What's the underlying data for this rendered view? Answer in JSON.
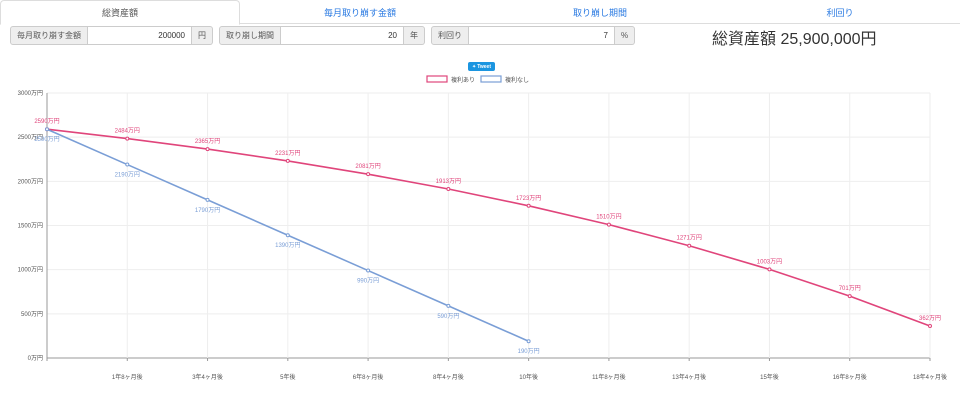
{
  "tabs": [
    {
      "label": "総資産額",
      "active": true
    },
    {
      "label": "毎月取り崩す金額",
      "active": false
    },
    {
      "label": "取り崩し期間",
      "active": false
    },
    {
      "label": "利回り",
      "active": false
    }
  ],
  "controls": {
    "monthly": {
      "label": "毎月取り崩す金額",
      "value": "200000",
      "unit": "円"
    },
    "period": {
      "label": "取り崩し期間",
      "value": "20",
      "unit": "年"
    },
    "rate": {
      "label": "利回り",
      "value": "7",
      "unit": "%"
    }
  },
  "total_text": "総資産額 25,900,000円",
  "tweet_label": "Tweet",
  "colors": {
    "compound": "#e0457b",
    "simple": "#7a9ed6",
    "link": "#2a7ae2"
  },
  "chart_data": {
    "type": "line",
    "categories": [
      "",
      "1年8ヶ月後",
      "3年4ヶ月後",
      "5年後",
      "6年8ヶ月後",
      "8年4ヶ月後",
      "10年後",
      "11年8ヶ月後",
      "13年4ヶ月後",
      "15年後",
      "16年8ヶ月後",
      "18年4ヶ月後"
    ],
    "yticks": [
      "0万円",
      "500万円",
      "1000万円",
      "1500万円",
      "2000万円",
      "2500万円",
      "3000万円"
    ],
    "ylim": [
      0,
      3000
    ],
    "grid": true,
    "legend_position": "top-center",
    "series": [
      {
        "name": "複利あり",
        "color": "#e0457b",
        "values": [
          2590,
          2484,
          2365,
          2231,
          2081,
          1913,
          1723,
          1510,
          1271,
          1003,
          701,
          362
        ],
        "labels": [
          "2590万円",
          "2484万円",
          "2365万円",
          "2231万円",
          "2081万円",
          "1913万円",
          "1723万円",
          "1510万円",
          "1271万円",
          "1003万円",
          "701万円",
          "362万円"
        ]
      },
      {
        "name": "複利なし",
        "color": "#7a9ed6",
        "values": [
          2590,
          2190,
          1790,
          1390,
          990,
          590,
          190
        ],
        "labels": [
          "2590万円",
          "2190万円",
          "1790万円",
          "1390万円",
          "990万円",
          "590万円",
          "190万円"
        ]
      }
    ]
  }
}
